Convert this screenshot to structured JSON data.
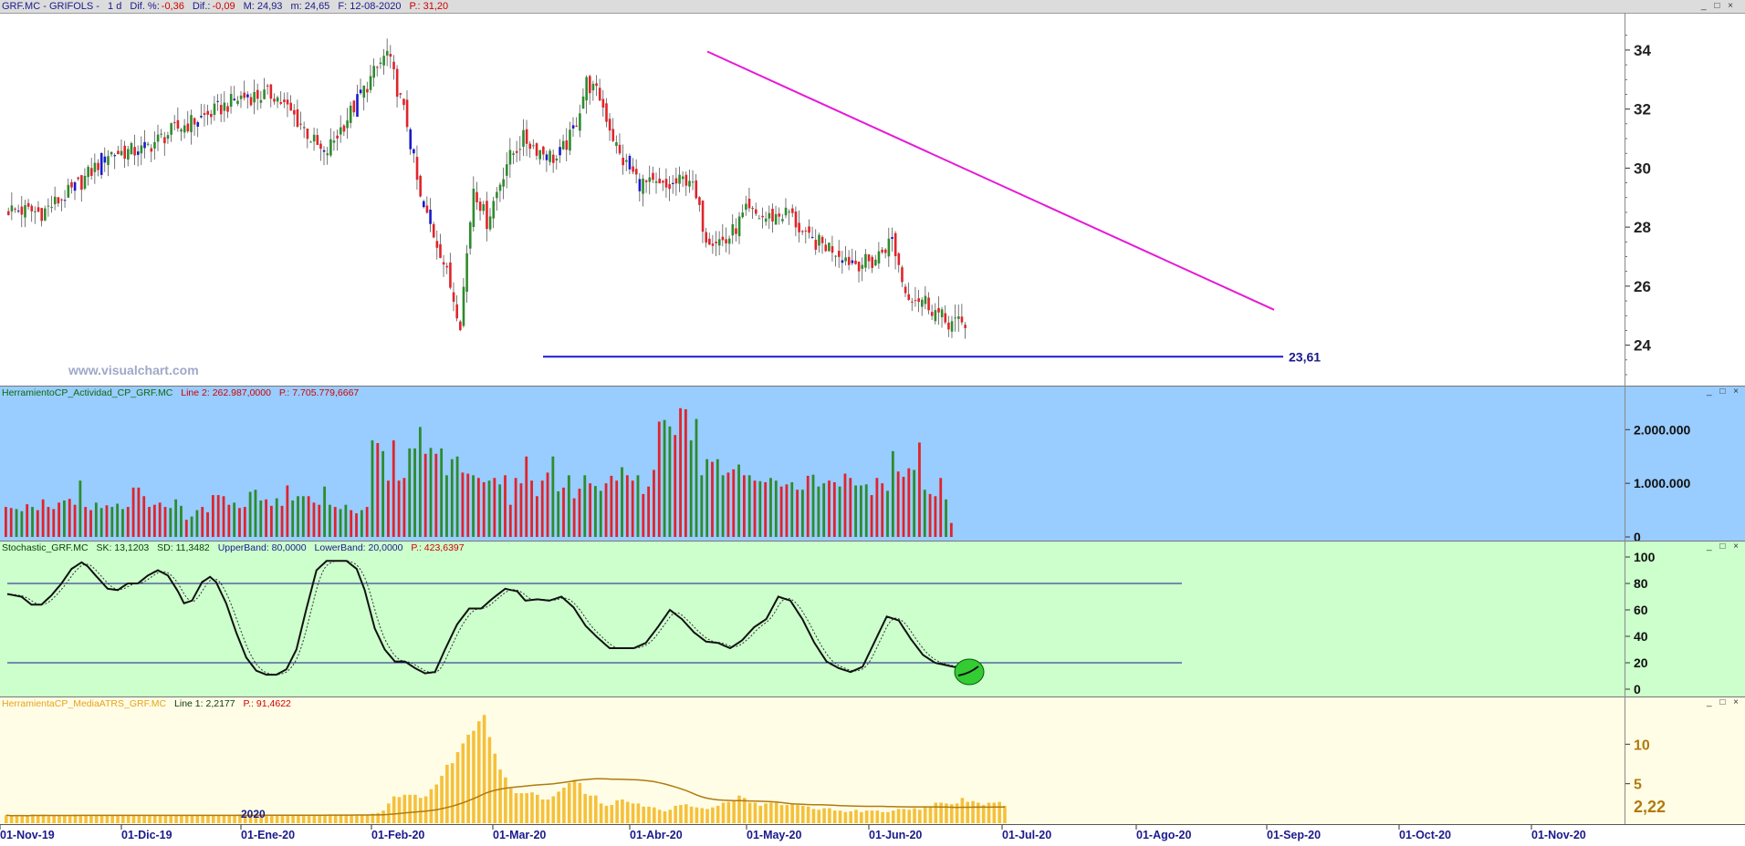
{
  "header": {
    "symbol": "GRF.MC - GRIFOLS -",
    "period": "1 d",
    "dif_pct_label": "Dif. %:",
    "dif_pct": "-0,36",
    "dif_label": "Dif.:",
    "dif": "-0,09",
    "max": "M: 24,93",
    "min": "m: 24,65",
    "date": "F: 12-08-2020",
    "p": "P.: 31,20",
    "window_buttons": "_ □ ×"
  },
  "watermark": "www.visualchart.com",
  "support_label": "23,61",
  "year_label": "2020",
  "panels": {
    "activity": {
      "name": "HerramientoCP_Actividad_CP_GRF.MC",
      "line": "Line 2: 262.987,0000",
      "p": "P.: 7.705.779,6667",
      "buttons": "_ □ ×"
    },
    "stochastic": {
      "name": "Stochastic_GRF.MC",
      "sk": "SK: 13,1203",
      "sd": "SD: 11,3482",
      "upper": "UpperBand: 80,0000",
      "lower": "LowerBand: 20,0000",
      "p": "P.: 423,6397",
      "buttons": "_ □ ×"
    },
    "atr": {
      "name": "HerramientaCP_MediaATRS_GRF.MC",
      "line": "Line 1: 2,2177",
      "p": "P.: 91,4622",
      "value_label": "2,22",
      "buttons": "_ □ ×"
    }
  },
  "colors": {
    "bull": "#2e8b2e",
    "bear": "#e0242a",
    "blue_bar": "#1a1acd",
    "trendline": "#e619d6",
    "support": "#1a1acd",
    "activity_bg": "#99ccff",
    "stoch_bg": "#ccffcc",
    "atr_bg": "#fffde6",
    "atr_bar": "#f5c03b",
    "atr_line": "#b07a10",
    "text_blue": "#1a1a8c"
  },
  "chart_data": [
    {
      "type": "candlestick",
      "title": "GRF.MC - GRIFOLS",
      "y_ticks": [
        "34",
        "32",
        "30",
        "28",
        "26",
        "24"
      ],
      "ylim": [
        23.0,
        34.8
      ],
      "x_tick_labels": [
        "01-Nov-19",
        "01-Dic-19",
        "01-Ene-20",
        "01-Feb-20",
        "01-Mar-20",
        "01-Abr-20",
        "01-May-20",
        "01-Jun-20",
        "01-Jul-20",
        "01-Ago-20",
        "01-Sep-20",
        "01-Oct-20",
        "01-Nov-20"
      ],
      "close_anchors": [
        [
          0,
          28.6
        ],
        [
          10,
          28.5
        ],
        [
          20,
          29.3
        ],
        [
          30,
          30.5
        ],
        [
          40,
          30.6
        ],
        [
          50,
          31.3
        ],
        [
          60,
          31.8
        ],
        [
          70,
          32.4
        ],
        [
          80,
          32.5
        ],
        [
          88,
          31.5
        ],
        [
          95,
          30.4
        ],
        [
          102,
          31.7
        ],
        [
          110,
          33.2
        ],
        [
          114,
          33.9
        ],
        [
          120,
          31.5
        ],
        [
          124,
          28.9
        ],
        [
          130,
          27.2
        ],
        [
          136,
          24.8
        ],
        [
          140,
          29.4
        ],
        [
          144,
          28.2
        ],
        [
          150,
          30.2
        ],
        [
          155,
          31.0
        ],
        [
          160,
          30.6
        ],
        [
          165,
          30.3
        ],
        [
          170,
          31.2
        ],
        [
          174,
          32.9
        ],
        [
          178,
          32.4
        ],
        [
          184,
          30.4
        ],
        [
          190,
          29.5
        ],
        [
          198,
          29.3
        ],
        [
          205,
          29.7
        ],
        [
          210,
          27.7
        ],
        [
          216,
          27.5
        ],
        [
          222,
          28.5
        ],
        [
          228,
          28.3
        ],
        [
          235,
          28.5
        ],
        [
          240,
          27.6
        ],
        [
          248,
          27.3
        ],
        [
          254,
          26.8
        ],
        [
          260,
          26.8
        ],
        [
          266,
          27.6
        ],
        [
          270,
          25.8
        ],
        [
          276,
          25.5
        ],
        [
          282,
          24.8
        ],
        [
          288,
          24.7
        ]
      ],
      "support": {
        "value": 23.61,
        "label": "23,61"
      },
      "trendline": {
        "from": [
          "12-Apr-20",
          33.95
        ],
        "to": [
          "10-Sep-20",
          25.2
        ]
      }
    },
    {
      "type": "bar",
      "title": "HerramientoCP_Actividad_CP_GRF.MC",
      "y_ticks": [
        "2.000.000",
        "1.000.000",
        "0"
      ],
      "ylim": [
        0,
        2600000
      ],
      "series": [
        {
          "name": "Actividad",
          "values": [
            560000,
            540000,
            520000,
            480000,
            610000,
            560000,
            500000,
            700000,
            560000,
            520000,
            640000,
            680000,
            710000,
            600000,
            1050000,
            560000,
            500000,
            640000,
            540000,
            590000,
            560000,
            620000,
            520000,
            560000,
            920000,
            920000,
            760000,
            560000,
            600000,
            640000,
            560000,
            540000,
            700000,
            580000,
            320000,
            380000,
            500000,
            560000,
            460000,
            780000,
            780000,
            760000,
            600000,
            640000,
            540000,
            560000,
            840000,
            880000,
            680000,
            700000,
            580000,
            720000,
            580000,
            960000,
            680000,
            760000,
            760000,
            760000,
            640000,
            600000,
            940000,
            600000,
            560000,
            520000,
            600000,
            500000,
            440000,
            500000,
            560000,
            1800000,
            1750000,
            1600000,
            1050000,
            1800000,
            1050000,
            1100000,
            1650000,
            1650000,
            2050000,
            1550000,
            1660000,
            1550000,
            1650000,
            1150000,
            1450000,
            1500000,
            1200000,
            1180000,
            1150000,
            1100000,
            1020000,
            1050000,
            1100000,
            980000,
            1150000,
            600000,
            1100000,
            1000000,
            1500000,
            1050000,
            760000,
            1050000,
            1200000,
            1500000,
            850000,
            920000,
            1150000,
            720000,
            900000,
            1150000,
            1000000,
            950000,
            860000,
            1000000,
            1140000,
            1050000,
            1300000,
            1150000,
            1050000,
            1150000,
            800000,
            940000,
            1250000,
            2150000,
            2180000,
            2060000,
            1900000,
            2400000,
            2380000,
            1800000,
            2200000,
            1150000,
            1450000,
            1400000,
            1450000,
            1150000,
            1200000,
            1260000,
            1350000,
            1150000,
            1150000,
            1050000,
            1040000,
            1020000,
            1100000,
            1050000,
            940000,
            980000,
            1020000,
            880000,
            880000,
            1140000,
            1160000,
            940000,
            1000000,
            1050000,
            1020000,
            940000,
            1180000,
            1100000,
            960000,
            960000,
            980000,
            780000,
            1100000,
            1000000,
            860000,
            1600000,
            1220000,
            1120000,
            1280000,
            1250000,
            1760000,
            880000,
            800000,
            760000,
            1100000,
            700000,
            260000
          ]
        }
      ]
    },
    {
      "type": "line",
      "title": "Stochastic_GRF.MC",
      "y_ticks": [
        "100",
        "80",
        "60",
        "40",
        "20",
        "0"
      ],
      "ylim": [
        0,
        100
      ],
      "bands": [
        80,
        20
      ],
      "sk_anchors": [
        [
          0,
          72
        ],
        [
          7,
          70
        ],
        [
          12,
          64
        ],
        [
          17,
          64
        ],
        [
          22,
          71
        ],
        [
          27,
          80
        ],
        [
          32,
          91
        ],
        [
          37,
          96
        ],
        [
          40,
          93
        ],
        [
          44,
          86
        ],
        [
          50,
          76
        ],
        [
          55,
          75
        ],
        [
          60,
          80
        ],
        [
          65,
          80
        ],
        [
          70,
          86
        ],
        [
          75,
          90
        ],
        [
          80,
          86
        ],
        [
          85,
          74
        ],
        [
          88,
          65
        ],
        [
          92,
          67
        ],
        [
          97,
          81
        ],
        [
          101,
          85
        ],
        [
          104,
          81
        ],
        [
          109,
          65
        ],
        [
          114,
          43
        ],
        [
          119,
          24
        ],
        [
          124,
          14
        ],
        [
          129,
          11
        ],
        [
          134,
          11
        ],
        [
          139,
          15
        ],
        [
          144,
          30
        ],
        [
          149,
          61
        ],
        [
          154,
          90
        ],
        [
          159,
          97
        ],
        [
          164,
          97
        ],
        [
          169,
          97
        ],
        [
          174,
          91
        ],
        [
          178,
          75
        ],
        [
          183,
          46
        ],
        [
          188,
          30
        ],
        [
          193,
          21
        ],
        [
          198,
          21
        ],
        [
          203,
          16
        ],
        [
          208,
          12
        ],
        [
          213,
          13
        ],
        [
          218,
          30
        ],
        [
          224,
          49
        ],
        [
          230,
          61
        ],
        [
          236,
          61
        ],
        [
          242,
          69
        ],
        [
          248,
          76
        ],
        [
          254,
          74
        ],
        [
          258,
          67
        ],
        [
          264,
          68
        ],
        [
          270,
          67
        ],
        [
          276,
          70
        ],
        [
          282,
          62
        ],
        [
          288,
          48
        ],
        [
          294,
          39
        ],
        [
          300,
          31
        ],
        [
          306,
          31
        ],
        [
          312,
          31
        ],
        [
          318,
          35
        ],
        [
          324,
          47
        ],
        [
          330,
          60
        ],
        [
          336,
          53
        ],
        [
          342,
          43
        ],
        [
          348,
          36
        ],
        [
          354,
          35
        ],
        [
          360,
          31
        ],
        [
          366,
          37
        ],
        [
          372,
          47
        ],
        [
          378,
          53
        ],
        [
          384,
          70
        ],
        [
          390,
          67
        ],
        [
          396,
          53
        ],
        [
          402,
          35
        ],
        [
          408,
          21
        ],
        [
          414,
          16
        ],
        [
          420,
          13
        ],
        [
          426,
          17
        ],
        [
          432,
          36
        ],
        [
          438,
          55
        ],
        [
          444,
          52
        ],
        [
          450,
          38
        ],
        [
          456,
          26
        ],
        [
          462,
          20
        ],
        [
          468,
          18
        ],
        [
          474,
          16
        ],
        [
          480,
          13
        ]
      ],
      "sk_last": 13.1203,
      "sd_last": 11.3482
    },
    {
      "type": "bar",
      "title": "HerramientaCP_MediaATRS_GRF.MC",
      "y_ticks": [
        "10",
        "5"
      ],
      "ylim": [
        0,
        15
      ],
      "series": [
        {
          "name": "ATR",
          "values": [
            1.0,
            0.9,
            1.0,
            1.0,
            0.9,
            1.1,
            1.0,
            1.0,
            0.9,
            1.0,
            1.0,
            1.0,
            0.9,
            1.1,
            1.0,
            1.0,
            1.0,
            1.0,
            1.0,
            1.0,
            1.0,
            1.0,
            1.0,
            1.0,
            1.0,
            1.0,
            1.0,
            1.0,
            1.0,
            1.0,
            1.0,
            1.0,
            1.0,
            1.0,
            1.0,
            1.0,
            1.0,
            1.0,
            1.0,
            1.0,
            1.0,
            1.0,
            1.0,
            1.0,
            1.0,
            1.0,
            1.0,
            1.0,
            1.0,
            1.0,
            1.0,
            1.0,
            1.0,
            1.1,
            1.1,
            1.1,
            1.1,
            1.1,
            1.1,
            1.1,
            1.1,
            1.1,
            1.1,
            1.1,
            1.1,
            1.1,
            1.1,
            1.1,
            1.1,
            1.2,
            1.3,
            1.6,
            2.5,
            3.4,
            3.3,
            3.6,
            3.6,
            3.6,
            3.2,
            3.4,
            4.3,
            4.9,
            6.0,
            7.4,
            7.6,
            9.0,
            10.1,
            11.2,
            11.7,
            12.9,
            13.7,
            10.9,
            8.8,
            6.8,
            5.8,
            4.4,
            3.8,
            3.8,
            3.8,
            3.9,
            3.6,
            3.0,
            3.0,
            3.4,
            4.0,
            4.5,
            5.1,
            5.5,
            5.1,
            3.7,
            3.5,
            3.5,
            2.5,
            2.2,
            2.3,
            2.9,
            3.0,
            2.7,
            2.5,
            2.5,
            2.1,
            2.1,
            2.0,
            1.7,
            1.5,
            1.7,
            2.2,
            2.3,
            2.4,
            2.1,
            2.0,
            1.9,
            1.8,
            2.0,
            2.2,
            2.6,
            2.7,
            2.9,
            3.5,
            3.2,
            2.6,
            2.6,
            2.2,
            2.5,
            2.6,
            2.6,
            2.3,
            2.3,
            2.5,
            2.3,
            2.2,
            2.1,
            1.8,
            1.7,
            1.9,
            1.9,
            1.6,
            1.6,
            1.4,
            1.5,
            1.7,
            1.4,
            1.6,
            1.6,
            1.6,
            1.4,
            1.4,
            1.6,
            1.8,
            1.8,
            1.7,
            1.9,
            1.7,
            2.0,
            2.1,
            2.6,
            2.6,
            2.5,
            2.4,
            2.5,
            3.2,
            2.7,
            2.8,
            2.6,
            2.3,
            2.6,
            2.6,
            2.7,
            2.2
          ]
        }
      ],
      "avg_line_last": 2.2177,
      "value_label": "2,22"
    }
  ]
}
